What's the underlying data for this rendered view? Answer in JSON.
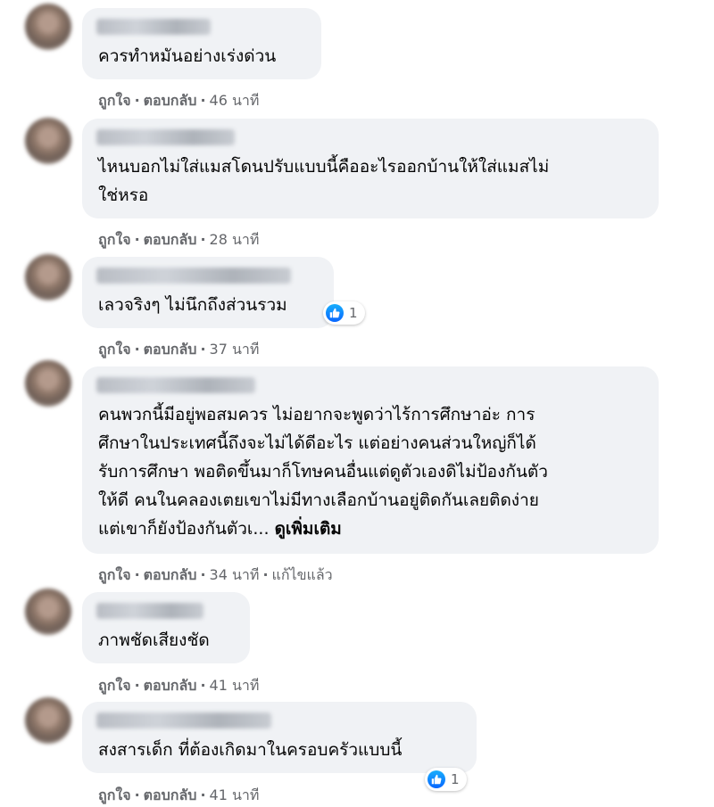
{
  "actions": {
    "like": "ถูกใจ",
    "reply": "ตอบกลับ"
  },
  "comments": [
    {
      "text": "ควรทำหมันอย่างเร่งด่วน",
      "time": "46 นาที"
    },
    {
      "text": "ไหนบอกไม่ใส่แมสโดนปรับแบบนี้คืออะไรออกบ้านให้ใส่แมสไม่\nใช่หรอ",
      "time": "28 นาที"
    },
    {
      "text": "เลวจริงๆ ไม่นึกถึงส่วนรวม",
      "time": "37 นาที",
      "reaction_icon": "like-icon",
      "reaction_count": "1"
    },
    {
      "text": "คนพวกนี้มีอยู่พอสมควร ไม่อยากจะพูดว่าไร้การศึกษาอ่ะ การ\nศึกษาในประเทศนี้ถึงจะไม่ได้ดีอะไร แต่อย่างคนส่วนใหญ่ก็ได้\nรับการศึกษา พอติดขึ้นมาก็โทษคนอื่นแต่ดูตัวเองดิไม่ป้องกันตัว\nให้ดี คนในคลองเตยเขาไม่มีทางเลือกบ้านอยู่ติดกันเลยติดง่าย\nแต่เขาก็ยังป้องกันตัวเ... ",
      "see_more": "ดูเพิ่มเติม",
      "time": "34 นาที",
      "edited": "แก้ไขแล้ว"
    },
    {
      "text": "ภาพชัดเสียงชัด",
      "time": "41 นาที"
    },
    {
      "text": "สงสารเด็ก ที่ต้องเกิดมาในครอบครัวแบบนี้",
      "time": "41 นาที",
      "reaction_icon": "like-icon",
      "reaction_count": "1"
    }
  ],
  "colors": {
    "bubble": "#f0f2f5",
    "meta_text": "#65676b",
    "like_blue": "#0866ff"
  }
}
